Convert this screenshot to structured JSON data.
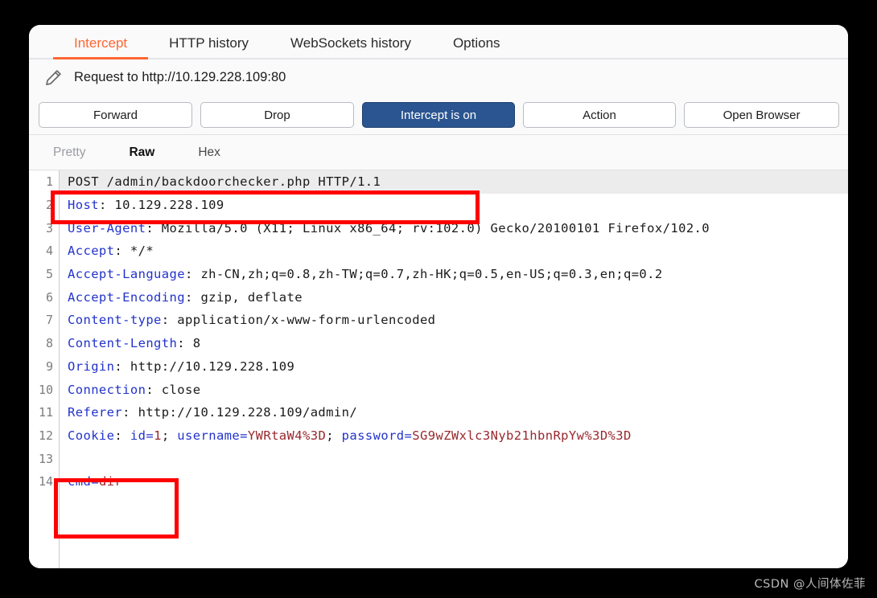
{
  "window": {
    "tabs": [
      {
        "label": "Intercept",
        "active": true
      },
      {
        "label": "HTTP history",
        "active": false
      },
      {
        "label": "WebSockets history",
        "active": false
      },
      {
        "label": "Options",
        "active": false
      }
    ],
    "accent_color": "#ff6633",
    "primary_button_color": "#2a5591",
    "annotation_color": "#ff0000"
  },
  "request_header": {
    "icon": "pencil-icon",
    "title": "Request to http://10.129.228.109:80"
  },
  "toolbar": {
    "forward_label": "Forward",
    "drop_label": "Drop",
    "intercept_label": "Intercept is on",
    "action_label": "Action",
    "open_browser_label": "Open Browser"
  },
  "view_tabs": {
    "pretty_label": "Pretty",
    "raw_label": "Raw",
    "hex_label": "Hex",
    "selected": "Raw"
  },
  "request": {
    "lines": [
      {
        "num": "1",
        "kind": "request-line",
        "highlight": true,
        "method": "POST",
        "path": "/admin/backdoorchecker.php",
        "version": "HTTP/1.1",
        "text": "POST /admin/backdoorchecker.php HTTP/1.1"
      },
      {
        "num": "2",
        "kind": "header",
        "name": "Host",
        "value": "10.129.228.109"
      },
      {
        "num": "3",
        "kind": "header",
        "name": "User-Agent",
        "value": "Mozilla/5.0 (X11; Linux x86_64; rv:102.0) Gecko/20100101 Firefox/102.0"
      },
      {
        "num": "4",
        "kind": "header",
        "name": "Accept",
        "value": "*/*"
      },
      {
        "num": "5",
        "kind": "header",
        "name": "Accept-Language",
        "value": "zh-CN,zh;q=0.8,zh-TW;q=0.7,zh-HK;q=0.5,en-US;q=0.3,en;q=0.2"
      },
      {
        "num": "6",
        "kind": "header",
        "name": "Accept-Encoding",
        "value": "gzip, deflate"
      },
      {
        "num": "7",
        "kind": "header",
        "name": "Content-type",
        "value": "application/x-www-form-urlencoded"
      },
      {
        "num": "8",
        "kind": "header",
        "name": "Content-Length",
        "value": "8"
      },
      {
        "num": "9",
        "kind": "header",
        "name": "Origin",
        "value": "http://10.129.228.109"
      },
      {
        "num": "10",
        "kind": "header",
        "name": "Connection",
        "value": "close"
      },
      {
        "num": "11",
        "kind": "header",
        "name": "Referer",
        "value": "http://10.129.228.109/admin/"
      },
      {
        "num": "12",
        "kind": "cookie",
        "name": "Cookie",
        "cookies": [
          {
            "key": "id",
            "value": "1",
            "sep": "; "
          },
          {
            "key": "username",
            "value": "YWRtaW4%3D",
            "sep": "; "
          },
          {
            "key": "password",
            "value": "SG9wZWxlc3Nyb21hbnRpYw%3D%3D",
            "sep": ""
          }
        ]
      },
      {
        "num": "13",
        "kind": "blank",
        "text": ""
      },
      {
        "num": "14",
        "kind": "body-param",
        "key": "cmd",
        "value": "dir",
        "text": "cmd=dir"
      }
    ]
  },
  "watermark": {
    "text": "CSDN @人间体佐菲"
  }
}
